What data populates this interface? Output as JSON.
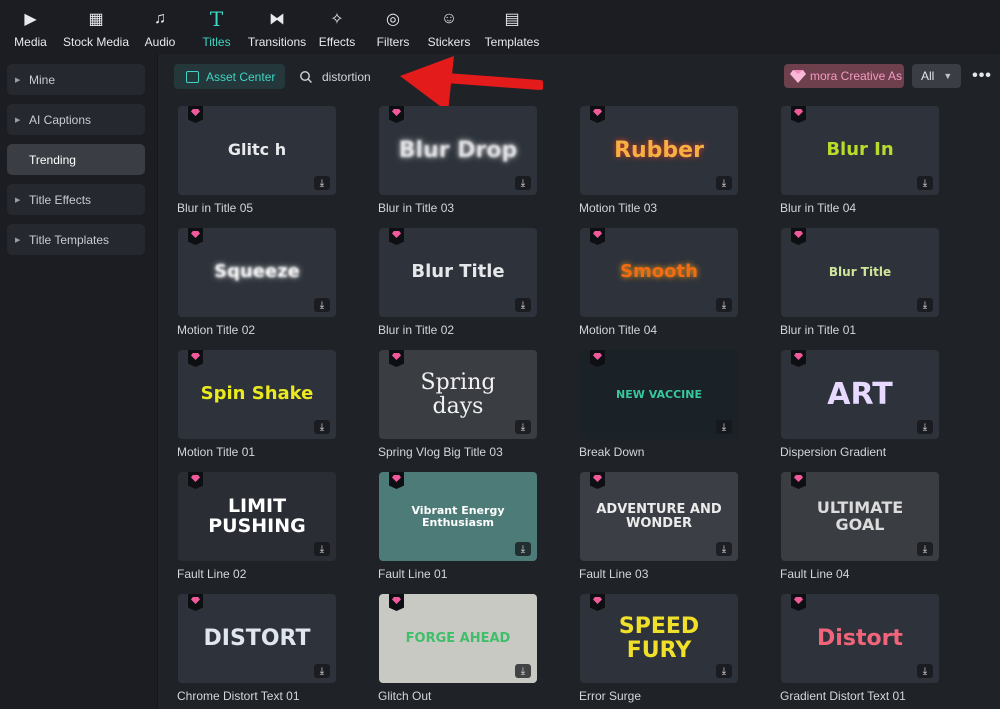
{
  "toolbar": {
    "items": [
      {
        "label": "Media",
        "icon": "media-icon",
        "glyph": "▶"
      },
      {
        "label": "Stock Media",
        "icon": "stock-media-icon",
        "glyph": "▦"
      },
      {
        "label": "Audio",
        "icon": "audio-icon",
        "glyph": "♫"
      },
      {
        "label": "Titles",
        "icon": "titles-icon",
        "glyph": "T"
      },
      {
        "label": "Transitions",
        "icon": "transitions-icon",
        "glyph": "⧓"
      },
      {
        "label": "Effects",
        "icon": "effects-icon",
        "glyph": "✧"
      },
      {
        "label": "Filters",
        "icon": "filters-icon",
        "glyph": "◎"
      },
      {
        "label": "Stickers",
        "icon": "stickers-icon",
        "glyph": "☺"
      },
      {
        "label": "Templates",
        "icon": "templates-icon",
        "glyph": "▤"
      }
    ],
    "active": "Titles"
  },
  "sidebar": {
    "items": [
      {
        "label": "Mine",
        "caret": true
      },
      {
        "label": "AI Captions",
        "caret": true
      },
      {
        "label": "Trending",
        "caret": false,
        "active": true
      },
      {
        "label": "Title Effects",
        "caret": true
      },
      {
        "label": "Title Templates",
        "caret": true
      }
    ]
  },
  "header": {
    "asset_center_label": "Asset Center",
    "search_value": "distortion",
    "creative_label": "mora Creative As",
    "filter_value": "All",
    "more_label": "•••"
  },
  "colors": {
    "accent": "#3fd6c4",
    "premium_pink": "#f05a9b",
    "annotation_red": "#e41b1b"
  },
  "cards": [
    {
      "caption": "Blur in Title 05",
      "art": "Glitc h",
      "art_color": "#e9eaee",
      "art_size": 16,
      "bg": "#2e333b"
    },
    {
      "caption": "Blur in Title 03",
      "art": "Blur Drop",
      "art_color": "#e6e7ea",
      "art_size": 22,
      "bg": "#2e333b",
      "blur": true
    },
    {
      "caption": "Motion Title 03",
      "art": "Rubber",
      "art_color": "#f5b042",
      "art_size": 22,
      "bg": "#2e333b",
      "glow": "#d03a2a"
    },
    {
      "caption": "Blur in Title 04",
      "art": "Blur In",
      "art_color": "#b9dc2c",
      "art_size": 18,
      "bg": "#2e333b"
    },
    {
      "caption": "Motion Title 02",
      "art": "Squeeze",
      "art_color": "#ffffff",
      "art_size": 18,
      "bg": "#2e333b",
      "blur": true
    },
    {
      "caption": "Blur in Title 02",
      "art": "Blur Title",
      "art_color": "#e6e7ea",
      "art_size": 18,
      "bg": "#2e333b"
    },
    {
      "caption": "Motion Title 04",
      "art": "Smooth",
      "art_color": "#f36b12",
      "art_size": 18,
      "bg": "#2e333b",
      "glow": "#f39b1a"
    },
    {
      "caption": "Blur in Title 01",
      "art": "Blur Title",
      "art_color": "#cfe59a",
      "art_size": 12,
      "bg": "#2e333b"
    },
    {
      "caption": "Motion Title 01",
      "art": "Spin Shake",
      "art_color": "#eaea1f",
      "art_size": 18,
      "bg": "#2e333b"
    },
    {
      "caption": "Spring Vlog Big Title 03",
      "art": "Spring days",
      "art_color": "#f2f2f2",
      "art_size": 22,
      "bg": "#3a3d42",
      "serif": true
    },
    {
      "caption": "Break Down",
      "art": "NEW VACCINE",
      "art_color": "#37c79c",
      "art_size": 11,
      "bg": "#1b2227"
    },
    {
      "caption": "Dispersion Gradient",
      "art": "ART",
      "art_color": "#e7d9ff",
      "art_size": 30,
      "bg": "#2e333b"
    },
    {
      "caption": "Fault Line 02",
      "art": "LIMIT PUSHING",
      "art_color": "#ffffff",
      "art_size": 19,
      "bg": "#2a2d33"
    },
    {
      "caption": "Fault Line 01",
      "art": "Vibrant Energy Enthusiasm",
      "art_color": "#ffffff",
      "art_size": 11,
      "bg": "#4d7c78"
    },
    {
      "caption": "Fault Line 03",
      "art": "ADVENTURE AND WONDER",
      "art_color": "#ececec",
      "art_size": 13,
      "bg": "#3b3e44"
    },
    {
      "caption": "Fault Line 04",
      "art": "ULTIMATE GOAL",
      "art_color": "#dcdcdc",
      "art_size": 16,
      "bg": "#3a3d42"
    },
    {
      "caption": "Chrome Distort Text 01",
      "art": "DISTORT",
      "art_color": "#dfe6ee",
      "art_size": 22,
      "bg": "#2e333b"
    },
    {
      "caption": "Glitch Out",
      "art": "FORGE AHEAD",
      "art_color": "#3fbf6a",
      "art_size": 13,
      "bg": "#c9c9c4"
    },
    {
      "caption": "Error Surge",
      "art": "SPEED FURY",
      "art_color": "#f0e02a",
      "art_size": 22,
      "bg": "#2e333b"
    },
    {
      "caption": "Gradient Distort Text 01",
      "art": "Distort",
      "art_color": "#f2647a",
      "art_size": 22,
      "bg": "#2e333b"
    }
  ]
}
